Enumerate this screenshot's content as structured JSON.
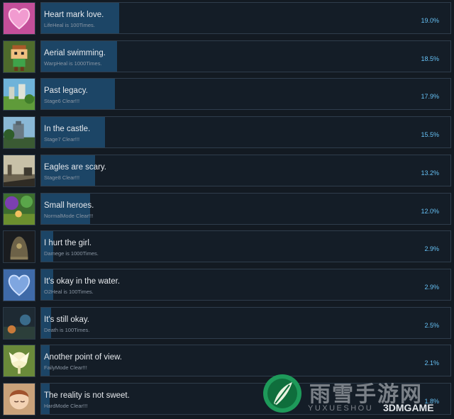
{
  "achievements": [
    {
      "title": "Heart mark love.",
      "desc": "LifeHeal is 100Times.",
      "pct_label": "19.0%",
      "pct": 19.0,
      "icon": "pink-heart-icon"
    },
    {
      "title": "Aerial swimming.",
      "desc": "WarpHeal is 1000Times.",
      "pct_label": "18.5%",
      "pct": 18.5,
      "icon": "pixel-character-icon"
    },
    {
      "title": "Past legacy.",
      "desc": "Stage6 Clear!!!",
      "pct_label": "17.9%",
      "pct": 17.9,
      "icon": "ruins-scene-icon"
    },
    {
      "title": "In the castle.",
      "desc": "Stage7 Clear!!!",
      "pct_label": "15.5%",
      "pct": 15.5,
      "icon": "castle-scene-icon"
    },
    {
      "title": "Eagles are scary.",
      "desc": "Stage8 Clear!!!",
      "pct_label": "13.2%",
      "pct": 13.2,
      "icon": "cliff-scene-icon"
    },
    {
      "title": "Small heroes.",
      "desc": "NormalMode Clear!!!",
      "pct_label": "12.0%",
      "pct": 12.0,
      "icon": "forest-scene-icon"
    },
    {
      "title": "I hurt the girl.",
      "desc": "Damege is 1000Times.",
      "pct_label": "2.9%",
      "pct": 2.9,
      "icon": "dark-bell-icon"
    },
    {
      "title": "It's okay in the water.",
      "desc": "O2Heal is 100Times.",
      "pct_label": "2.9%",
      "pct": 2.9,
      "icon": "blue-heart-icon"
    },
    {
      "title": "It's still okay.",
      "desc": "Death is 100Times.",
      "pct_label": "2.5%",
      "pct": 2.5,
      "icon": "dark-scene-icon"
    },
    {
      "title": "Another point of view.",
      "desc": "FailyMode Clear!!!",
      "pct_label": "2.1%",
      "pct": 2.1,
      "icon": "fairy-icon"
    },
    {
      "title": "The reality is not sweet.",
      "desc": "HardMode Clear!!!",
      "pct_label": "1.8%",
      "pct": 1.8,
      "icon": "sleeping-girl-icon"
    }
  ],
  "watermark": {
    "cn": "雨雪手游网",
    "en": "YUXUESHOU",
    "brand": "3DMGAME"
  },
  "colors": {
    "background": "#131a22",
    "fill": "#1c4566",
    "percent": "#66c0f4"
  }
}
